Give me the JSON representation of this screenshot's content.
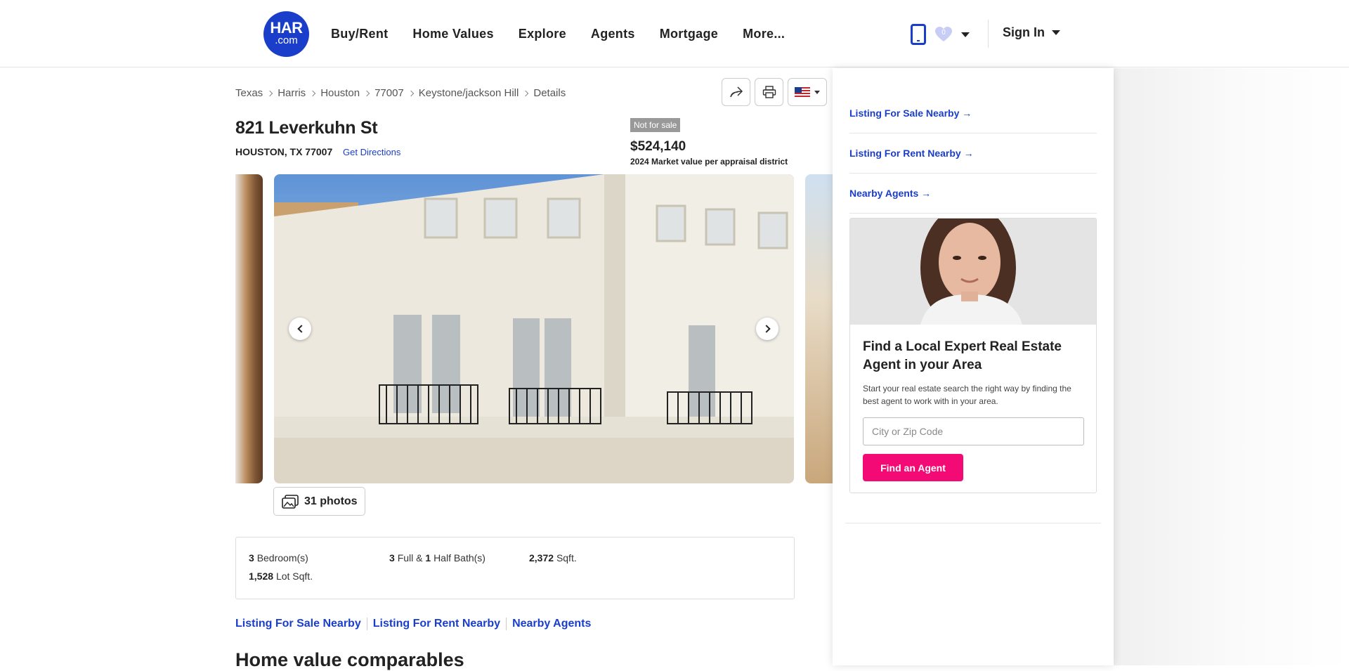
{
  "brand": {
    "logo_line1": "HAR",
    "logo_line2": ".com",
    "accent": "#1a3ec9",
    "cta_color": "#f30a74"
  },
  "nav": {
    "items": [
      "Buy/Rent",
      "Home Values",
      "Explore",
      "Agents",
      "Mortgage",
      "More..."
    ]
  },
  "header": {
    "favorites_count": "0",
    "sign_in": "Sign In"
  },
  "breadcrumb": [
    "Texas",
    "Harris",
    "Houston",
    "77007",
    "Keystone/jackson Hill",
    "Details"
  ],
  "listing": {
    "address": "821 Leverkuhn St",
    "city_line": "HOUSTON, TX 77007",
    "directions": "Get Directions",
    "status": "Not for sale",
    "price": "$524,140",
    "price_note": "2024 Market value per appraisal district",
    "photos_label": "31 photos"
  },
  "facts": {
    "bedrooms": {
      "value": "3",
      "label": "Bedroom(s)"
    },
    "baths": {
      "full": "3",
      "mid": "Full &",
      "half": "1",
      "label": "Half Bath(s)"
    },
    "sqft": {
      "value": "2,372",
      "label": "Sqft."
    },
    "lot": {
      "value": "1,528",
      "label": "Lot Sqft."
    }
  },
  "links": [
    "Listing For Sale Nearby",
    "Listing For Rent Nearby",
    "Nearby Agents"
  ],
  "section_title": "Home value comparables",
  "sidebar": {
    "links": [
      "Listing For Sale Nearby →",
      "Listing For Rent Nearby →",
      "Nearby Agents →"
    ],
    "card_title": "Find a Local Expert Real Estate Agent in your Area",
    "card_text": "Start your real estate search the right way by finding the best agent to work with in your area.",
    "input_placeholder": "City or Zip Code",
    "button": "Find an Agent"
  }
}
